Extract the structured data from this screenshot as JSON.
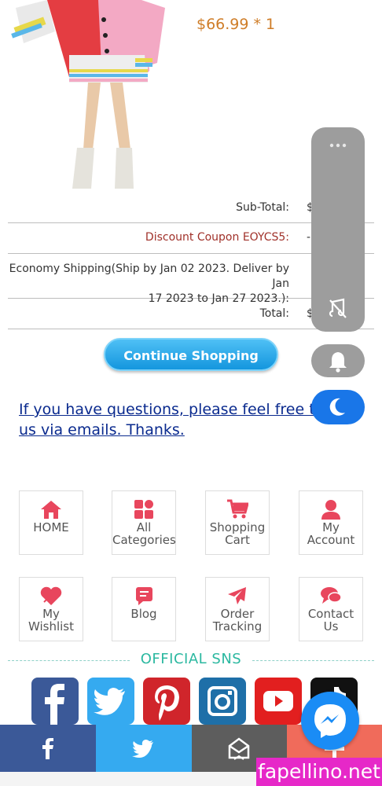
{
  "order": {
    "price": "$66.99 * 1",
    "rows": [
      {
        "label": "Sub-Total:",
        "value": "$"
      },
      {
        "label": "Discount Coupon EOYCS5:",
        "value": "-"
      },
      {
        "label_line1": "Economy Shipping(Ship by Jan 02 2023. Deliver by Jan",
        "label_line2": "17 2023 to Jan 27 2023.):",
        "value": ""
      },
      {
        "label": "Total:",
        "value": "$"
      }
    ]
  },
  "continue_button": "Continue Shopping",
  "questions": {
    "line1": "If you have questions, please feel free to c",
    "line2": "us via emails. Thanks."
  },
  "nav_grid": [
    {
      "line1": "HOME",
      "line2": "",
      "icon": "home-icon"
    },
    {
      "line1": "All",
      "line2": "Categories",
      "icon": "categories-icon"
    },
    {
      "line1": "Shopping",
      "line2": "Cart",
      "icon": "cart-icon"
    },
    {
      "line1": "My Account",
      "line2": "",
      "icon": "user-icon"
    },
    {
      "line1": "My Wishlist",
      "line2": "",
      "icon": "heart-icon"
    },
    {
      "line1": "Blog",
      "line2": "",
      "icon": "blog-icon"
    },
    {
      "line1": "Order",
      "line2": "Tracking",
      "icon": "plane-icon"
    },
    {
      "line1": "Contact Us",
      "line2": "",
      "icon": "chat-icon"
    }
  ],
  "sns": {
    "title": "OFFICIAL SNS",
    "items": [
      "facebook-icon",
      "twitter-icon",
      "pinterest-icon",
      "instagram-icon",
      "youtube-icon",
      "tiktok-icon"
    ]
  },
  "colors": {
    "price": "#cf7d28",
    "discount": "#a0312a",
    "accent": "#e8465d",
    "sns_title": "#2bb8a0",
    "button": "#1496de",
    "link": "#0a2a8e"
  },
  "share_bar": [
    "facebook-icon",
    "twitter-icon",
    "email-icon",
    "plus-icon"
  ],
  "watermark": "fapellino.net"
}
